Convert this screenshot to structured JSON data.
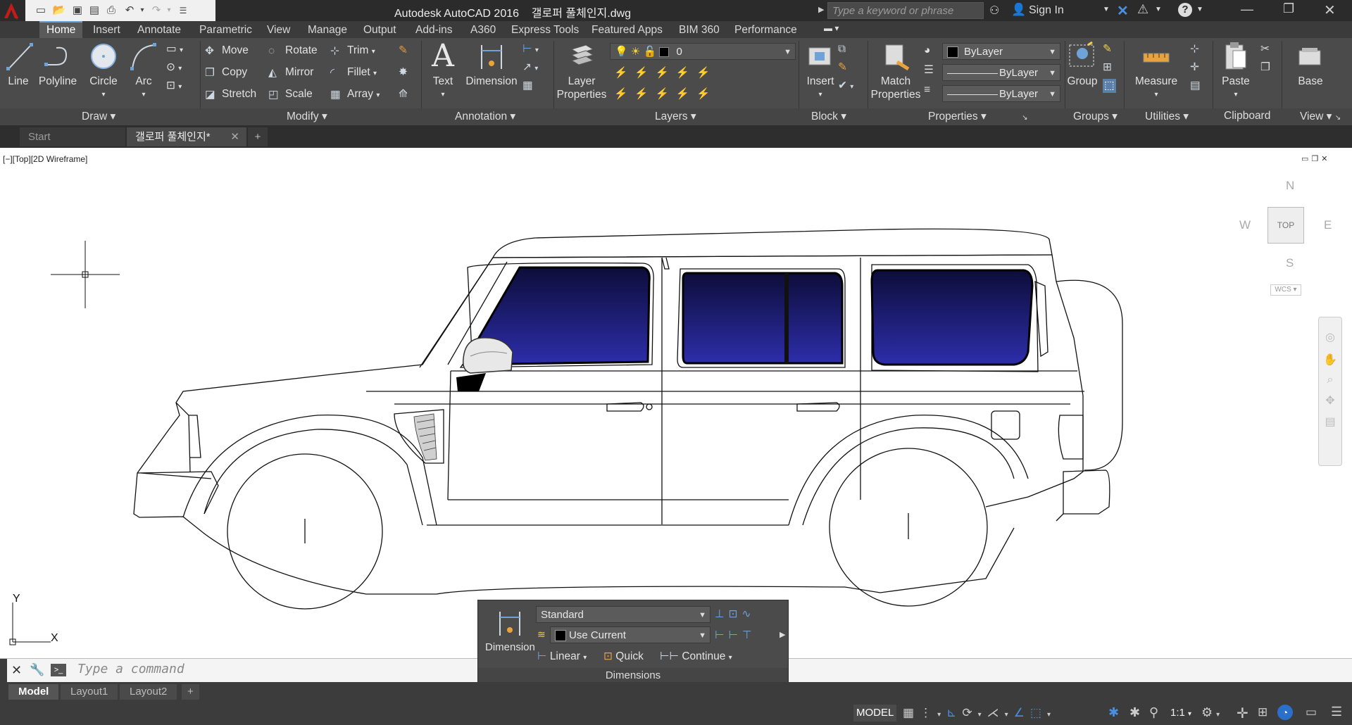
{
  "app": {
    "title": "Autodesk AutoCAD 2016",
    "filename": "갤로퍼 풀체인지.dwg"
  },
  "search": {
    "placeholder": "Type a keyword or phrase"
  },
  "account": {
    "sign_in": "Sign In"
  },
  "ribbon_tabs": [
    "Home",
    "Insert",
    "Annotate",
    "Parametric",
    "View",
    "Manage",
    "Output",
    "Add-ins",
    "A360",
    "Express Tools",
    "Featured Apps",
    "BIM 360",
    "Performance"
  ],
  "active_tab": "Home",
  "draw": {
    "line": "Line",
    "polyline": "Polyline",
    "circle": "Circle",
    "arc": "Arc",
    "panel": "Draw"
  },
  "modify": {
    "move": "Move",
    "rotate": "Rotate",
    "trim": "Trim",
    "copy": "Copy",
    "mirror": "Mirror",
    "fillet": "Fillet",
    "stretch": "Stretch",
    "scale": "Scale",
    "array": "Array",
    "panel": "Modify"
  },
  "annotation": {
    "text": "Text",
    "dimension": "Dimension",
    "panel": "Annotation"
  },
  "layers": {
    "layer_properties_1": "Layer",
    "layer_properties_2": "Properties",
    "current_layer": "0",
    "panel": "Layers"
  },
  "block": {
    "insert": "Insert",
    "panel": "Block"
  },
  "properties": {
    "match_1": "Match",
    "match_2": "Properties",
    "color": "ByLayer",
    "linetype": "ByLayer",
    "lineweight": "ByLayer",
    "panel": "Properties"
  },
  "groups": {
    "group": "Group",
    "panel": "Groups"
  },
  "utilities": {
    "measure": "Measure",
    "panel": "Utilities"
  },
  "clipboard": {
    "paste": "Paste",
    "panel": "Clipboard"
  },
  "view_panel": {
    "base": "Base",
    "panel": "View"
  },
  "doc_tabs": {
    "start": "Start",
    "current": "갤로퍼 풀체인지*"
  },
  "viewport": {
    "label": "[−][Top][2D Wireframe]"
  },
  "viewcube": {
    "n": "N",
    "s": "S",
    "e": "E",
    "w": "W",
    "face": "TOP",
    "wcs": "WCS"
  },
  "ucs": {
    "x": "X",
    "y": "Y"
  },
  "command": {
    "placeholder": "Type a command"
  },
  "layout_tabs": [
    "Model",
    "Layout1",
    "Layout2"
  ],
  "status": {
    "model": "MODEL",
    "scale": "1:1"
  },
  "dim_palette": {
    "big_label": "Dimension",
    "style": "Standard",
    "layer": "Use Current",
    "linear": "Linear",
    "quick": "Quick",
    "continue": "Continue",
    "title": "Dimensions"
  },
  "colors": {
    "ribbon_bg": "#4b4b4b",
    "titlebar_bg": "#2b2b2b",
    "window_glass": "#1c1c7a",
    "acad_red": "#c41a1a"
  }
}
